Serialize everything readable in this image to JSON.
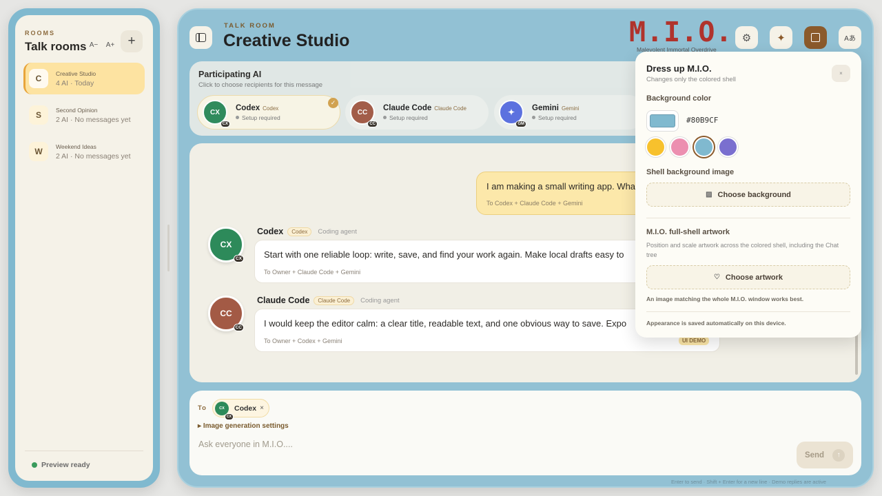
{
  "sidebar": {
    "section_label": "ROOMS",
    "title": "Talk rooms",
    "font_smaller": "A−",
    "font_larger": "A+",
    "add_label": "+",
    "rooms": [
      {
        "initial": "C",
        "name": "Creative Studio",
        "meta": "4 AI · Today",
        "active": true
      },
      {
        "initial": "S",
        "name": "Second Opinion",
        "meta": "2 AI · No messages yet",
        "active": false
      },
      {
        "initial": "W",
        "name": "Weekend Ideas",
        "meta": "2 AI · No messages yet",
        "active": false
      }
    ],
    "status": "Preview ready"
  },
  "header": {
    "label": "TALK ROOM",
    "title": "Creative Studio",
    "logo": "M.I.O.",
    "logo_sub": "Malevolent Immortal Overdrive",
    "buttons": [
      {
        "icon": "gear-icon",
        "glyph": "⚙"
      },
      {
        "icon": "sparkle-icon",
        "glyph": "✦"
      },
      {
        "icon": "square-icon",
        "glyph": ""
      },
      {
        "icon": "translate-icon",
        "glyph": "Aあ"
      }
    ]
  },
  "participants": {
    "title": "Participating AI",
    "subtitle": "Click to choose recipients for this message",
    "agents": [
      {
        "abbr": "CX",
        "name": "Codex",
        "tag": "Codex",
        "status": "Setup required",
        "color": "#2d8a5a",
        "selected": true
      },
      {
        "abbr": "CC",
        "name": "Claude Code",
        "tag": "Claude Code",
        "status": "Setup required",
        "color": "#a35a45",
        "selected": false
      },
      {
        "abbr": "✦",
        "badge": "GM",
        "name": "Gemini",
        "tag": "Gemini",
        "status": "Setup required",
        "color": "#5b6fe0",
        "selected": false
      }
    ]
  },
  "chat": {
    "user_message": {
      "text": "I am making a small writing app. Wha",
      "to": "To Codex + Claude Code + Gemini"
    },
    "messages": [
      {
        "abbr": "CX",
        "name": "Codex",
        "tag": "Codex",
        "role": "Coding agent",
        "color": "#2d8a5a",
        "text": "Start with one reliable loop: write, save, and find your work again. Make local drafts easy to",
        "to": "To Owner + Claude Code + Gemini"
      },
      {
        "abbr": "CC",
        "name": "Claude Code",
        "tag": "Claude Code",
        "role": "Coding agent",
        "color": "#a35a45",
        "text": "I would keep the editor calm: a clear title, readable text, and one obvious way to save. Expo",
        "to": "To Owner + Codex + Gemini"
      }
    ],
    "demo_badge": "UI DEMO"
  },
  "composer": {
    "to_label": "To",
    "recipient": {
      "abbr": "CX",
      "name": "Codex",
      "remove": "×"
    },
    "image_settings": "Image generation settings",
    "placeholder": "Ask everyone in M.I.O....",
    "send_label": "Send",
    "send_arrow": "↑",
    "hint": "Enter to send · Shift + Enter for a new line · Demo replies are active"
  },
  "dress_panel": {
    "title": "Dress up M.I.O.",
    "subtitle": "Changes only the colored shell",
    "close": "×",
    "bg_color_label": "Background color",
    "bg_color_hex": "#80B9CF",
    "swatches": [
      "#f7c12d",
      "#ec8fb0",
      "#80b9cf",
      "#7a6fcf"
    ],
    "selected_swatch": 2,
    "shell_image_label": "Shell background image",
    "choose_background": "Choose background",
    "artwork_label": "M.I.O. full-shell artwork",
    "artwork_desc": "Position and scale artwork across the colored shell, including the Chat tree",
    "choose_artwork": "Choose artwork",
    "artwork_hint": "An image matching the whole M.I.O. window works best.",
    "saved_note": "Appearance is saved automatically on this device."
  }
}
